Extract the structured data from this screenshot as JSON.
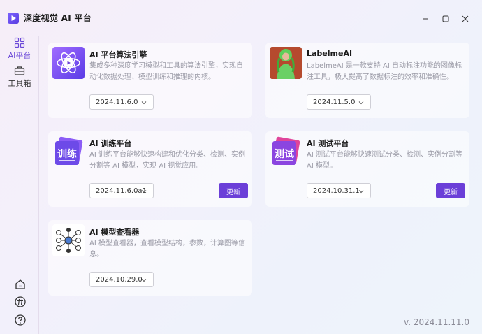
{
  "window": {
    "title": "深度视觉 AI 平台"
  },
  "sidebar": {
    "items": [
      {
        "label": "AI平台",
        "icon": "grid-icon",
        "active": true
      },
      {
        "label": "工具箱",
        "icon": "toolbox-icon",
        "active": false
      }
    ],
    "bottom_icons": [
      "home-icon",
      "hash-icon",
      "help-icon"
    ]
  },
  "cards": [
    {
      "title": "AI 平台算法引擎",
      "desc": "集成多种深度学习模型和工具的算法引擎，实现自动化数据处理、模型训练和推理的内核。",
      "version": "2024.11.6.0",
      "has_update": false,
      "icon": "atom-play-icon"
    },
    {
      "title": "LabelmeAI",
      "desc": "LabelmeAI 是一款支持 AI 自动标注功能的图像标注工具，极大提高了数据标注的效率和准确性。",
      "version": "2024.11.5.0",
      "has_update": false,
      "icon": "labelme-icon"
    },
    {
      "title": "AI 训练平台",
      "desc": "AI 训练平台能够快速构建和优化分类、检测、实例分割等 AI 模型，实现 AI 视觉应用。",
      "version": "2024.11.6.0a1",
      "has_update": true,
      "update_label": "更新",
      "icon": "train-icon",
      "icon_text": "训练"
    },
    {
      "title": "AI 测试平台",
      "desc": "AI 测试平台能够快速测试分类、检测、实例分割等 AI 模型。",
      "version": "2024.10.31.1",
      "has_update": true,
      "update_label": "更新",
      "icon": "test-icon",
      "icon_text": "测试"
    },
    {
      "title": "AI 模型查看器",
      "desc": "AI 模型查看器，查看模型结构，参数，计算图等信息。",
      "version": "2024.10.29.0",
      "has_update": false,
      "icon": "model-graph-icon"
    }
  ],
  "footer": {
    "version": "v. 2024.11.11.0"
  },
  "colors": {
    "accent": "#6b3fd8",
    "active_nav": "#6b48d8"
  }
}
